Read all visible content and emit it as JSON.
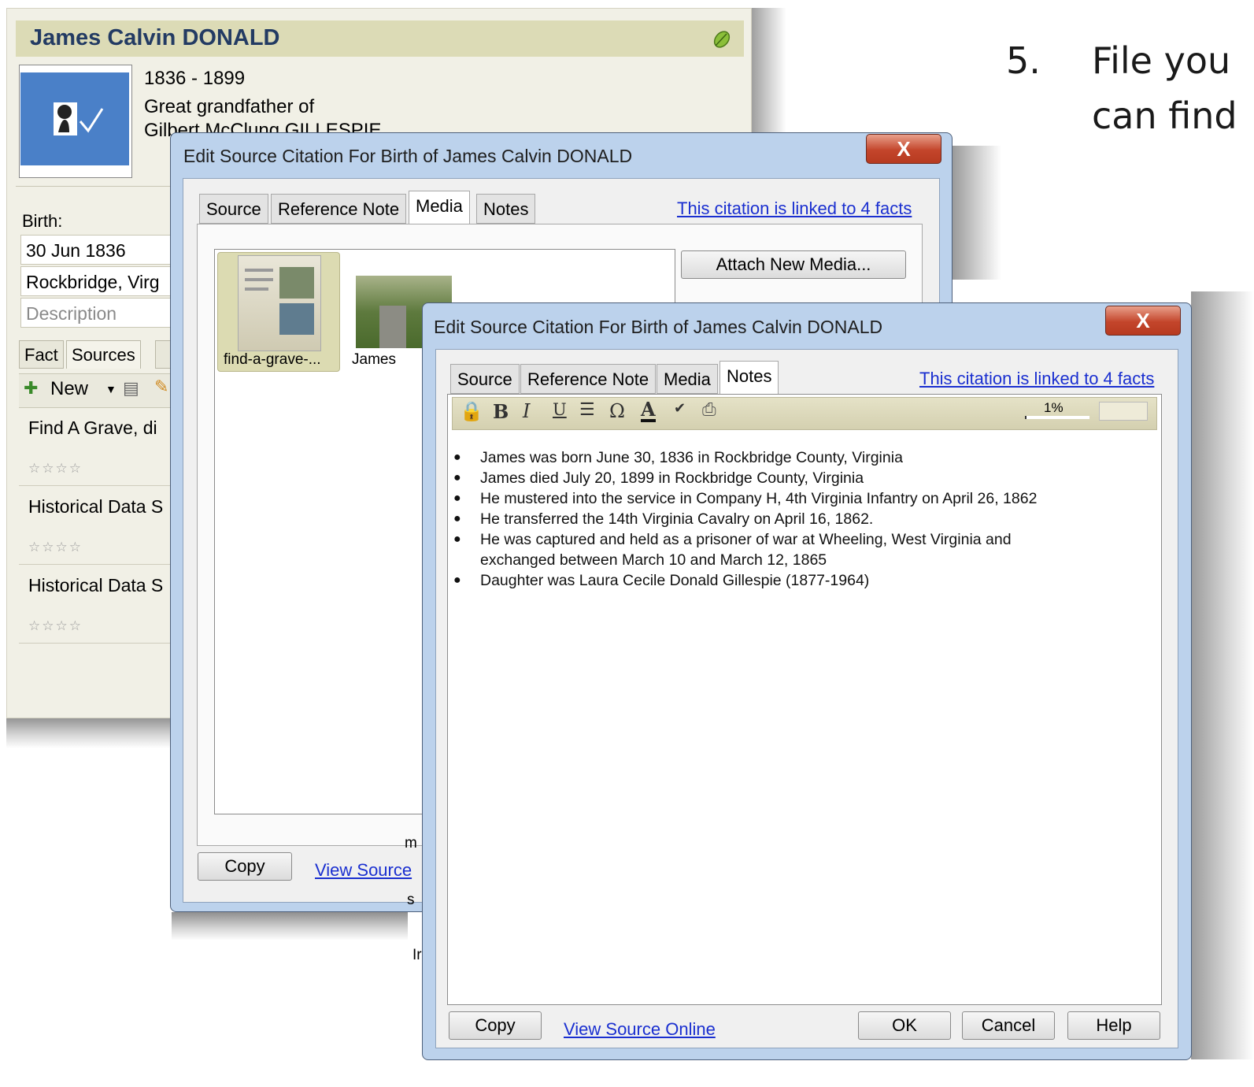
{
  "slide": {
    "number": "5.",
    "line1": "File you",
    "line2": "can find"
  },
  "person": {
    "name": "James Calvin DONALD",
    "life_span": "1836 - 1899",
    "relationship_line1": "Great grandfather of",
    "relationship_line2": "Gilbert McClung GILLESPIE",
    "birth_label": "Birth:",
    "birth_date": "30 Jun 1836",
    "birth_place": "Rockbridge, Virg",
    "description_placeholder": "Description",
    "tabs": [
      "Fact",
      "Sources"
    ],
    "new_button": "New",
    "sources": [
      {
        "title": "Find A Grave, di",
        "stars": "☆☆☆☆"
      },
      {
        "title": "Historical Data S",
        "stars": "☆☆☆☆"
      },
      {
        "title": "Historical Data S",
        "stars": "☆☆☆☆"
      }
    ]
  },
  "dialog_back": {
    "title": "Edit Source Citation For Birth of James Calvin DONALD",
    "close": "X",
    "tabs": [
      "Source",
      "Reference Note",
      "Media",
      "Notes"
    ],
    "active_tab": "Media",
    "linked_link": "This citation is linked to 4 facts",
    "attach_button": "Attach New Media...",
    "media_items": [
      {
        "caption": "find-a-grave-..."
      },
      {
        "caption": "James"
      }
    ],
    "copy_button": "Copy",
    "view_source_link": "View Source"
  },
  "dialog_front": {
    "title": "Edit Source Citation For Birth of James Calvin DONALD",
    "close": "X",
    "tabs": [
      "Source",
      "Reference Note",
      "Media",
      "Notes"
    ],
    "active_tab": "Notes",
    "linked_link": "This citation is linked to 4 facts",
    "zoom": "1%",
    "notes": [
      "James was born June 30, 1836 in Rockbridge County, Virginia",
      "James died July 20, 1899 in Rockbridge County, Virginia",
      "He mustered into the service in Company H, 4th Virginia Infantry on April 26, 1862",
      "He transferred the 14th Virginia Cavalry on April 16, 1862.",
      "He was captured and held as a prisoner of war at Wheeling, West Virginia and",
      "exchanged between March 10 and March 12, 1865",
      "Daughter was Laura Cecile Donald Gillespie (1877-1964)"
    ],
    "copy_button": "Copy",
    "view_source_online_link": "View Source Online",
    "ok_button": "OK",
    "cancel_button": "Cancel",
    "help_button": "Help"
  },
  "obscured_fragments": [
    "m",
    "s",
    "Ir"
  ],
  "colors": {
    "panel_header": "#dcdbb6",
    "name_text": "#233b63",
    "dialog_frame": "#bcd2ec",
    "close_red": "#c3452b",
    "link_blue": "#1a2fd0"
  }
}
